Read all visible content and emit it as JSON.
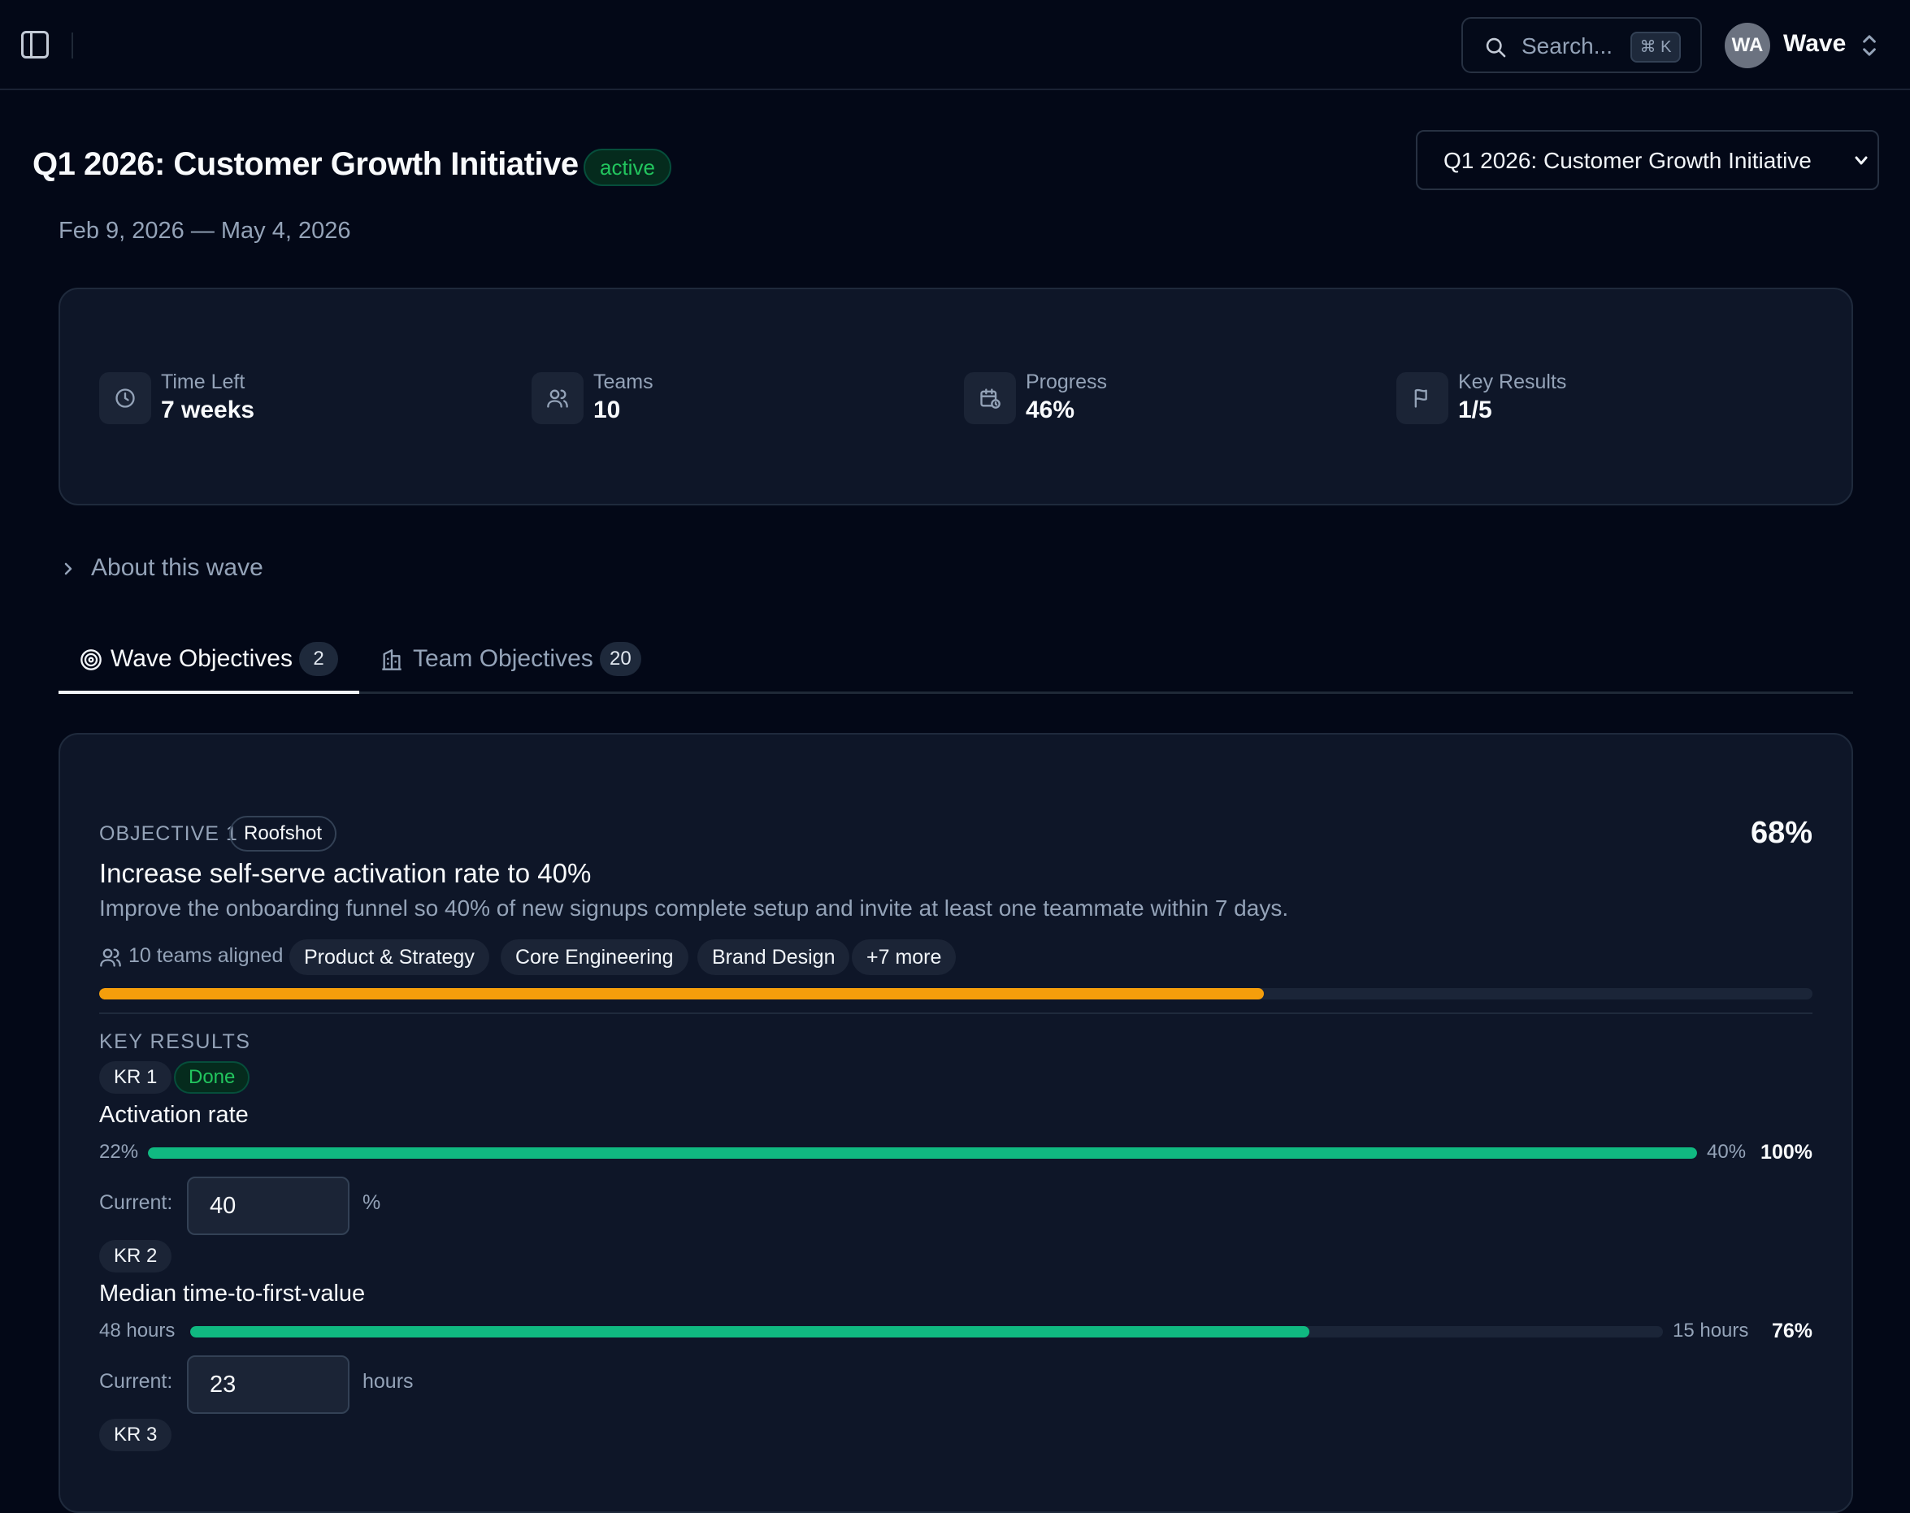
{
  "topbar": {
    "search_placeholder": "Search...",
    "search_shortcut": "⌘ K",
    "avatar_initials": "WA",
    "workspace_name": "Wave"
  },
  "header": {
    "title": "Q1 2026: Customer Growth Initiative",
    "status": "active",
    "date_range": "Feb 9, 2026 — May 4, 2026",
    "wave_select_value": "Q1 2026: Customer Growth Initiative"
  },
  "stats": [
    {
      "label": "Time Left",
      "value": "7 weeks",
      "icon": "clock-icon"
    },
    {
      "label": "Teams",
      "value": "10",
      "icon": "users-icon"
    },
    {
      "label": "Progress",
      "value": "46%",
      "icon": "calendar-clock-icon"
    },
    {
      "label": "Key Results",
      "value": "1/5",
      "icon": "flag-icon"
    }
  ],
  "about": {
    "label": "About this wave"
  },
  "tabs": [
    {
      "label": "Wave Objectives",
      "count": "2",
      "icon": "target-icon",
      "active": true
    },
    {
      "label": "Team Objectives",
      "count": "20",
      "icon": "building-icon",
      "active": false
    }
  ],
  "objective": {
    "number": "OBJECTIVE 1",
    "type": "Roofshot",
    "title": "Increase self-serve activation rate to 40%",
    "description": "Improve the onboarding funnel so 40% of new signups complete setup and invite at least one teammate within 7 days.",
    "progress_label": "68%",
    "progress_value": 0.68,
    "progress_color": "#f59e0b",
    "teams_aligned": "10 teams aligned",
    "team_chips": [
      "Product & Strategy",
      "Core Engineering",
      "Brand Design",
      "+7 more"
    ],
    "key_results_heading": "KEY RESULTS"
  },
  "key_results": [
    {
      "tag": "KR 1",
      "status": "Done",
      "title": "Activation rate",
      "start": "22%",
      "target": "40%",
      "progress_label": "100%",
      "progress_value": 1.0,
      "current_label": "Current:",
      "current_value": "40",
      "unit": "%"
    },
    {
      "tag": "KR 2",
      "status": "",
      "title": "Median time-to-first-value",
      "start": "48 hours",
      "target": "15 hours",
      "progress_label": "76%",
      "progress_value": 0.76,
      "current_label": "Current:",
      "current_value": "23",
      "unit": "hours"
    },
    {
      "tag": "KR 3"
    }
  ],
  "colors": {
    "background": "#030817",
    "card": "#0e1628",
    "accent_green": "#10b981",
    "accent_orange": "#f59e0b",
    "badge_green": "#22c55e"
  }
}
